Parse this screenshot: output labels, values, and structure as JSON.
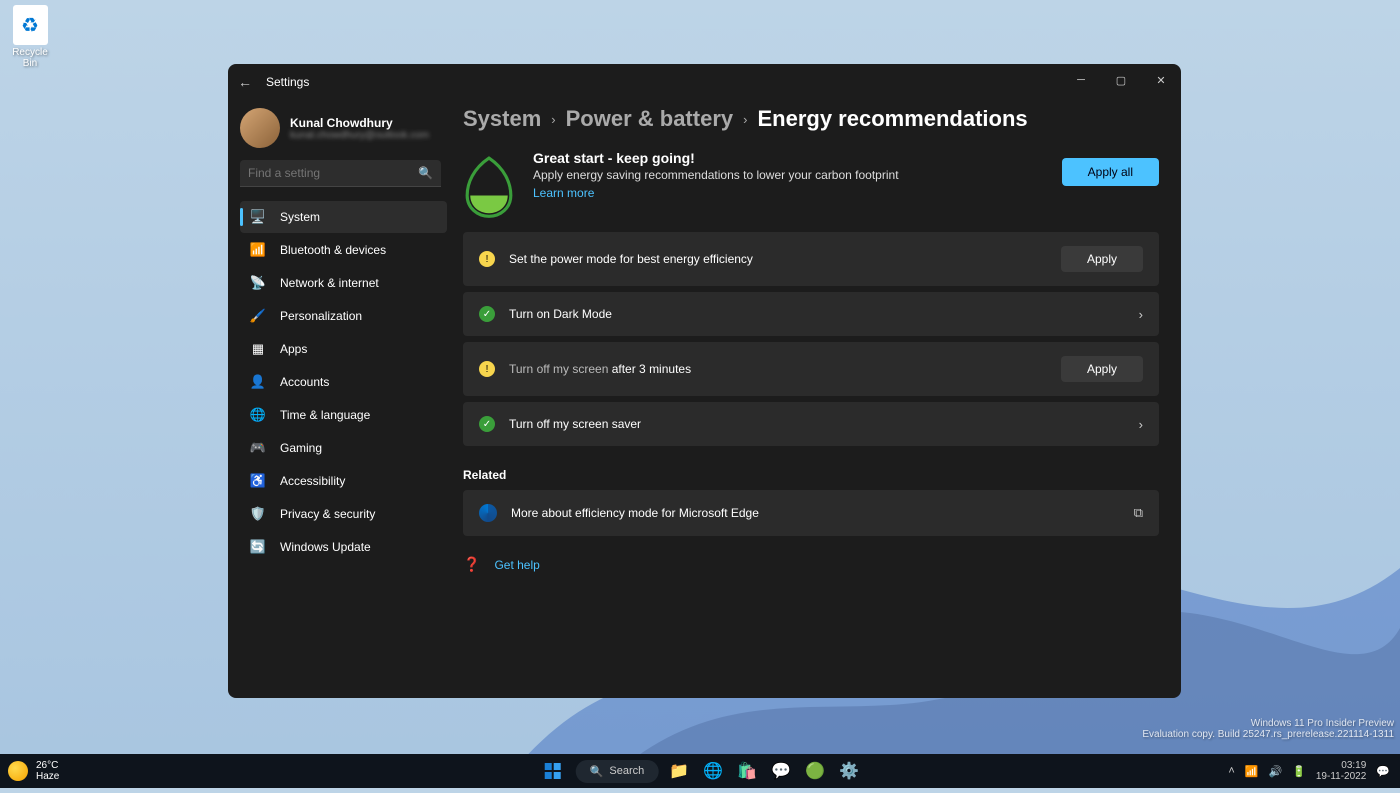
{
  "desktop": {
    "recycle_label": "Recycle Bin"
  },
  "build": {
    "line1": "Windows 11 Pro Insider Preview",
    "line2": "Evaluation copy. Build 25247.rs_prerelease.221114-1311"
  },
  "window": {
    "title": "Settings",
    "user": {
      "name": "Kunal Chowdhury",
      "email": "kunal.chowdhury@outlook.com"
    },
    "search_placeholder": "Find a setting"
  },
  "nav": {
    "items": [
      {
        "label": "System",
        "icon": "🖥️",
        "active": true
      },
      {
        "label": "Bluetooth & devices",
        "icon": "📶"
      },
      {
        "label": "Network & internet",
        "icon": "📡"
      },
      {
        "label": "Personalization",
        "icon": "🖌️"
      },
      {
        "label": "Apps",
        "icon": "▦"
      },
      {
        "label": "Accounts",
        "icon": "👤"
      },
      {
        "label": "Time & language",
        "icon": "🌐"
      },
      {
        "label": "Gaming",
        "icon": "🎮"
      },
      {
        "label": "Accessibility",
        "icon": "♿"
      },
      {
        "label": "Privacy & security",
        "icon": "🛡️"
      },
      {
        "label": "Windows Update",
        "icon": "🔄"
      }
    ]
  },
  "breadcrumb": {
    "a": "System",
    "b": "Power & battery",
    "c": "Energy recommendations"
  },
  "hero": {
    "title": "Great start - keep going!",
    "subtitle": "Apply energy saving recommendations to lower your carbon footprint",
    "learn": "Learn more",
    "apply_all": "Apply all"
  },
  "recs": [
    {
      "status": "warn",
      "text": "Set the power mode for best energy efficiency",
      "action": "apply"
    },
    {
      "status": "ok",
      "text": "Turn on Dark Mode",
      "action": "chevron"
    },
    {
      "status": "warn",
      "text_pre": "Turn off my screen",
      "text_post": " after 3 minutes",
      "action": "apply"
    },
    {
      "status": "ok",
      "text": "Turn off my screen saver",
      "action": "chevron"
    }
  ],
  "apply_label": "Apply",
  "related": {
    "heading": "Related",
    "edge": "More about efficiency mode for Microsoft Edge"
  },
  "help": "Get help",
  "taskbar": {
    "weather_temp": "26°C",
    "weather_cond": "Haze",
    "search": "Search",
    "time": "03:19",
    "date": "19-11-2022"
  }
}
